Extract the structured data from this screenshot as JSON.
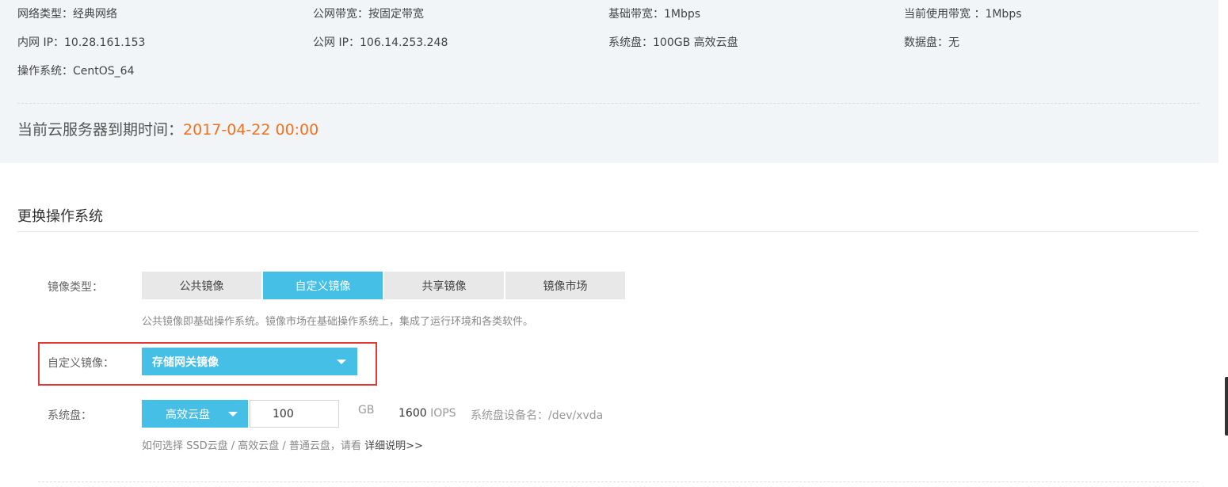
{
  "info": {
    "network_type": "网络类型：经典网络",
    "public_bandwidth": "公网带宽：按固定带宽",
    "base_bandwidth": "基础带宽：1Mbps",
    "current_bandwidth": "当前使用带宽 ：1Mbps",
    "private_ip": "内网 IP：10.28.161.153",
    "public_ip": "公网 IP：106.14.253.248",
    "system_disk": "系统盘：100GB 高效云盘",
    "data_disk": "数据盘：无",
    "os": "操作系统：CentOS_64"
  },
  "expiry": {
    "label": "当前云服务器到期时间：",
    "date": "2017-04-22 00:00"
  },
  "section": {
    "title": "更换操作系统"
  },
  "image_type": {
    "label": "镜像类型：",
    "tabs": [
      "公共镜像",
      "自定义镜像",
      "共享镜像",
      "镜像市场"
    ],
    "active_index": 1,
    "hint": "公共镜像即基础操作系统。镜像市场在基础操作系统上，集成了运行环境和各类软件。"
  },
  "custom_image": {
    "label": "自定义镜像：",
    "selected": "存储网关镜像"
  },
  "system_disk_form": {
    "label": "系统盘：",
    "type": "高效云盘",
    "size": "100",
    "unit": "GB",
    "iops_value": "1600",
    "iops_unit": " IOPS",
    "device": "系统盘设备名：/dev/xvda",
    "hint": "如何选择 SSD云盘 / 高效云盘 / 普通云盘，请看 ",
    "hint_link": "详细说明>>"
  },
  "colors": {
    "accent": "#45bfe6",
    "expiry_date": "#f2711c",
    "highlight": "#e53935"
  }
}
